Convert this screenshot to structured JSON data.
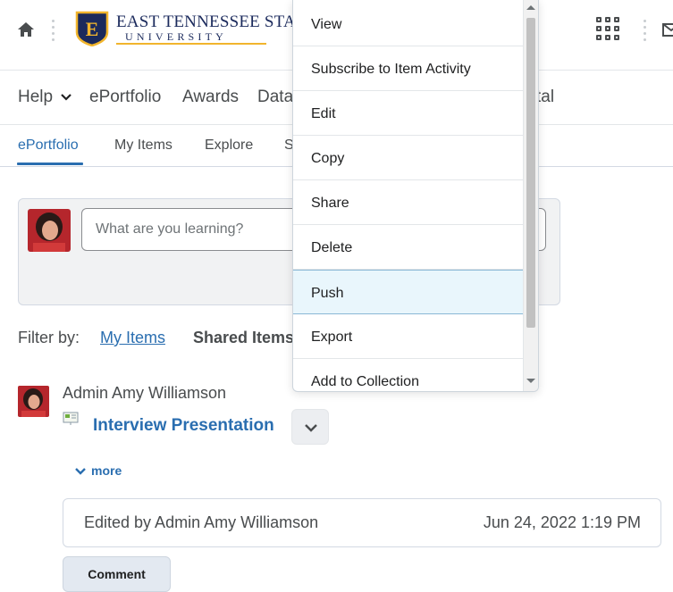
{
  "header": {
    "logo_line1": "EAST TENNESSEE STATE",
    "logo_line2": "UNIVERSITY",
    "logo_mark": "E",
    "icons": [
      "home-icon",
      "apps-grid-icon",
      "mail-icon"
    ]
  },
  "nav": {
    "items": [
      {
        "label": "Help"
      },
      {
        "label": "ePortfolio"
      },
      {
        "label": "Awards"
      },
      {
        "label": "Data"
      },
      {
        "label": "tal"
      }
    ]
  },
  "tabs": [
    {
      "label": "ePortfolio",
      "active": true
    },
    {
      "label": "My Items"
    },
    {
      "label": "Explore"
    },
    {
      "label": "S"
    }
  ],
  "post": {
    "placeholder": "What are you learning?"
  },
  "filter": {
    "label": "Filter by:",
    "my_items": "My Items",
    "shared_items": "Shared Items"
  },
  "item": {
    "author": "Admin Amy Williamson",
    "title": "Interview Presentation",
    "more": "more",
    "edited_by": "Edited by Admin Amy Williamson",
    "edited_date": "Jun 24, 2022 1:19 PM",
    "comment": "Comment"
  },
  "menu": {
    "items": [
      {
        "label": "View"
      },
      {
        "label": "Subscribe to Item Activity"
      },
      {
        "label": "Edit"
      },
      {
        "label": "Copy"
      },
      {
        "label": "Share"
      },
      {
        "label": "Delete"
      },
      {
        "label": "Push",
        "highlighted": true
      },
      {
        "label": "Export"
      },
      {
        "label": "Add to Collection"
      }
    ]
  },
  "colors": {
    "link": "#2a6eb0",
    "menu_highlight": "#e9f6fc",
    "brand_navy": "#1b2a5c",
    "brand_gold": "#f1b52d"
  }
}
